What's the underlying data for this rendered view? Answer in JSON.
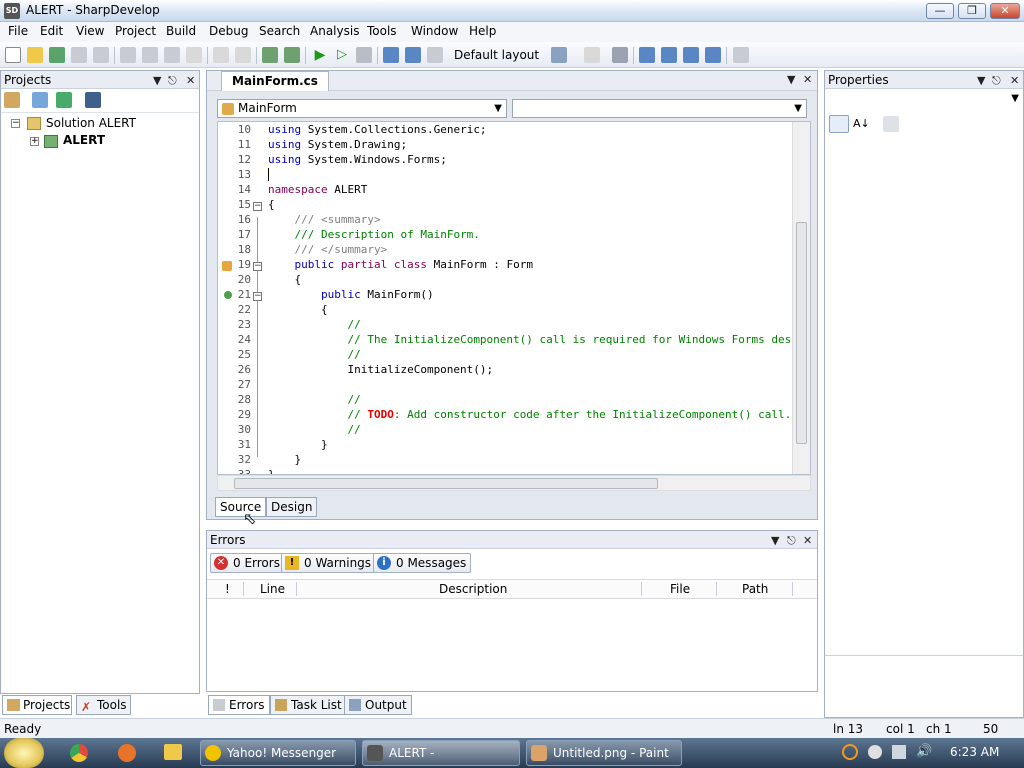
{
  "window": {
    "title": "ALERT - SharpDevelop",
    "app_icon": "SD"
  },
  "menu": [
    "File",
    "Edit",
    "View",
    "Project",
    "Build",
    "Debug",
    "Search",
    "Analysis",
    "Tools",
    "Window",
    "Help"
  ],
  "toolbar": {
    "layout_label": "Default layout"
  },
  "projects": {
    "header": "Projects",
    "tree": [
      {
        "label": "Solution ALERT"
      },
      {
        "label": "ALERT"
      }
    ],
    "tabs": [
      "Projects",
      "Tools"
    ]
  },
  "editor": {
    "file_tab": "MainForm.cs",
    "class_dropdown": "MainForm",
    "member_dropdown": "",
    "bottom_tabs": [
      "Source",
      "Design"
    ],
    "lines": [
      {
        "n": "10",
        "t": "using System.Collections.Generic;"
      },
      {
        "n": "11",
        "t": "using System.Drawing;"
      },
      {
        "n": "12",
        "t": "using System.Windows.Forms;"
      },
      {
        "n": "13",
        "t": ""
      },
      {
        "n": "14",
        "t": "namespace ALERT"
      },
      {
        "n": "15",
        "t": "{"
      },
      {
        "n": "16",
        "t": "    /// <summary>"
      },
      {
        "n": "17",
        "t": "    /// Description of MainForm."
      },
      {
        "n": "18",
        "t": "    /// </summary>"
      },
      {
        "n": "19",
        "t": "    public partial class MainForm : Form"
      },
      {
        "n": "20",
        "t": "    {"
      },
      {
        "n": "21",
        "t": "        public MainForm()"
      },
      {
        "n": "22",
        "t": "        {"
      },
      {
        "n": "23",
        "t": "            //"
      },
      {
        "n": "24",
        "t": "            // The InitializeComponent() call is required for Windows Forms designer support."
      },
      {
        "n": "25",
        "t": "            //"
      },
      {
        "n": "26",
        "t": "            InitializeComponent();"
      },
      {
        "n": "27",
        "t": ""
      },
      {
        "n": "28",
        "t": "            //"
      },
      {
        "n": "29",
        "t": "            // TODO: Add constructor code after the InitializeComponent() call."
      },
      {
        "n": "30",
        "t": "            //"
      },
      {
        "n": "31",
        "t": "        }"
      },
      {
        "n": "32",
        "t": "    }"
      },
      {
        "n": "33",
        "t": "}"
      }
    ]
  },
  "errors": {
    "header": "Errors",
    "filters": [
      "0 Errors",
      "0 Warnings",
      "0 Messages"
    ],
    "columns": [
      "!",
      "Line",
      "Description",
      "File",
      "Path"
    ],
    "tabs": [
      "Errors",
      "Task List",
      "Output"
    ]
  },
  "properties": {
    "header": "Properties"
  },
  "status": {
    "left": "Ready",
    "line": "ln 13",
    "col": "col 1",
    "ch": "ch 1",
    "num": "50"
  },
  "taskbar": {
    "items": [
      "Yahoo! Messenger",
      "ALERT - SharpDevelop",
      "Untitled.png - Paint"
    ],
    "clock": "6:23 AM"
  }
}
